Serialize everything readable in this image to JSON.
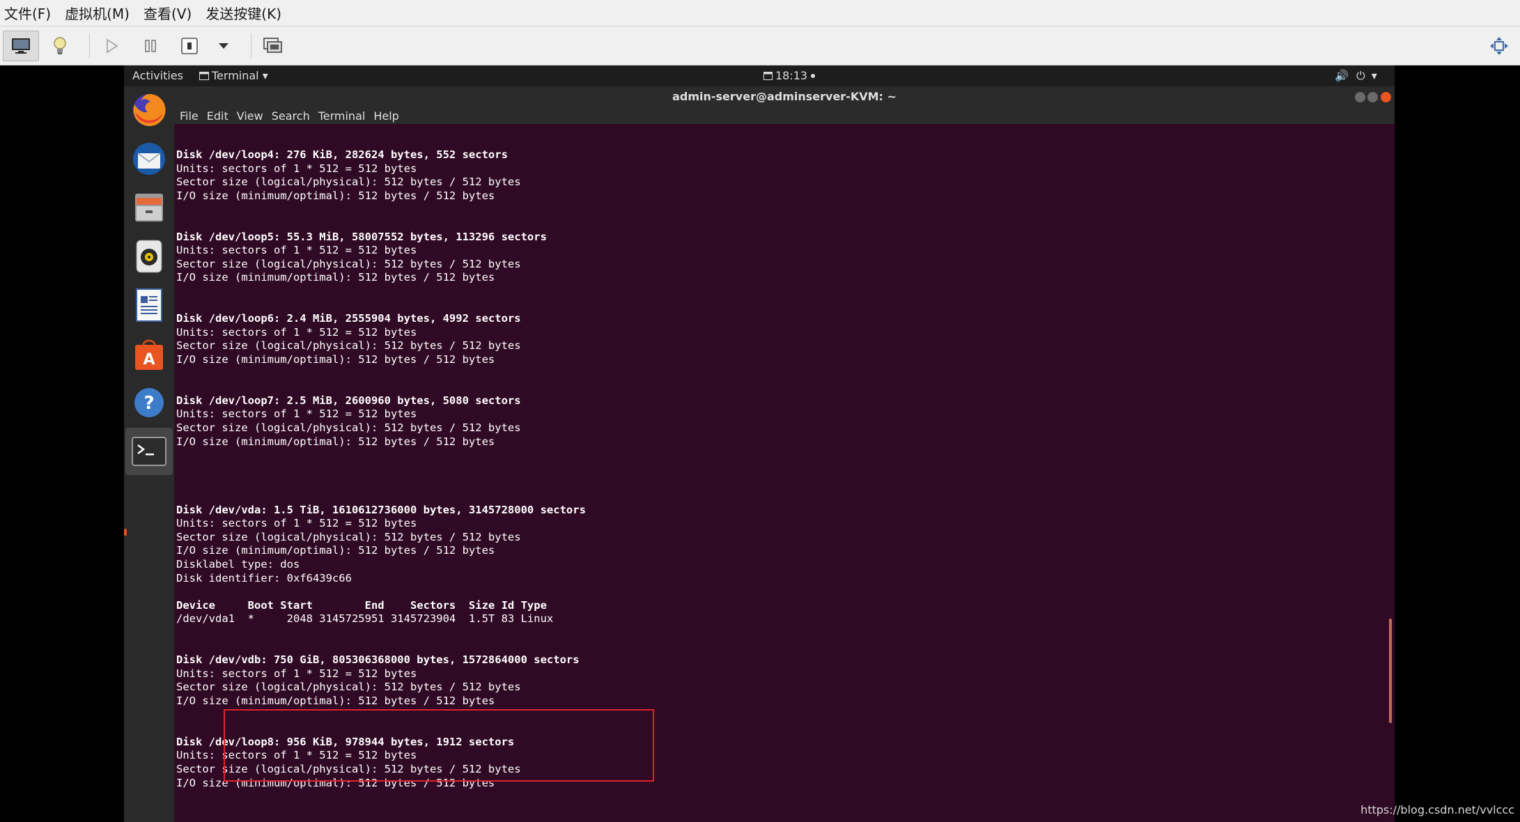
{
  "host": {
    "menu": [
      "文件(F)",
      "虚拟机(M)",
      "查看(V)",
      "发送按键(K)"
    ],
    "toolbar": [
      {
        "name": "display-icon"
      },
      {
        "name": "bulb-icon"
      },
      {
        "name": "play-icon"
      },
      {
        "name": "pause-icon"
      },
      {
        "name": "stop-icon"
      },
      {
        "name": "dropdown-arrow-icon"
      },
      {
        "name": "screens-icon"
      },
      {
        "name": "fullscreen-icon"
      }
    ]
  },
  "gnome": {
    "activities": "Activities",
    "app_menu": "Terminal",
    "clock": "18:13",
    "status_icons": [
      "volume-icon",
      "power-icon",
      "chevron-down-icon"
    ]
  },
  "dock": [
    {
      "name": "firefox-icon"
    },
    {
      "name": "thunderbird-icon"
    },
    {
      "name": "files-icon"
    },
    {
      "name": "rhythmbox-icon"
    },
    {
      "name": "libreoffice-writer-icon"
    },
    {
      "name": "software-center-icon"
    },
    {
      "name": "help-icon"
    },
    {
      "name": "terminal-icon"
    }
  ],
  "terminal": {
    "title": "admin-server@adminserver-KVM: ~",
    "menu": [
      "File",
      "Edit",
      "View",
      "Search",
      "Terminal",
      "Help"
    ],
    "lines": [
      {
        "text": "Disk /dev/loop4: 276 KiB, 282624 bytes, 552 sectors",
        "bold": true
      },
      {
        "text": "Units: sectors of 1 * 512 = 512 bytes"
      },
      {
        "text": "Sector size (logical/physical): 512 bytes / 512 bytes"
      },
      {
        "text": "I/O size (minimum/optimal): 512 bytes / 512 bytes"
      },
      {
        "text": ""
      },
      {
        "text": ""
      },
      {
        "text": "Disk /dev/loop5: 55.3 MiB, 58007552 bytes, 113296 sectors",
        "bold": true
      },
      {
        "text": "Units: sectors of 1 * 512 = 512 bytes"
      },
      {
        "text": "Sector size (logical/physical): 512 bytes / 512 bytes"
      },
      {
        "text": "I/O size (minimum/optimal): 512 bytes / 512 bytes"
      },
      {
        "text": ""
      },
      {
        "text": ""
      },
      {
        "text": "Disk /dev/loop6: 2.4 MiB, 2555904 bytes, 4992 sectors",
        "bold": true
      },
      {
        "text": "Units: sectors of 1 * 512 = 512 bytes"
      },
      {
        "text": "Sector size (logical/physical): 512 bytes / 512 bytes"
      },
      {
        "text": "I/O size (minimum/optimal): 512 bytes / 512 bytes"
      },
      {
        "text": ""
      },
      {
        "text": ""
      },
      {
        "text": "Disk /dev/loop7: 2.5 MiB, 2600960 bytes, 5080 sectors",
        "bold": true
      },
      {
        "text": "Units: sectors of 1 * 512 = 512 bytes"
      },
      {
        "text": "Sector size (logical/physical): 512 bytes / 512 bytes"
      },
      {
        "text": "I/O size (minimum/optimal): 512 bytes / 512 bytes"
      },
      {
        "text": ""
      },
      {
        "text": ""
      },
      {
        "text": ""
      },
      {
        "text": ""
      },
      {
        "text": "Disk /dev/vda: 1.5 TiB, 1610612736000 bytes, 3145728000 sectors",
        "bold": true
      },
      {
        "text": "Units: sectors of 1 * 512 = 512 bytes"
      },
      {
        "text": "Sector size (logical/physical): 512 bytes / 512 bytes"
      },
      {
        "text": "I/O size (minimum/optimal): 512 bytes / 512 bytes"
      },
      {
        "text": "Disklabel type: dos"
      },
      {
        "text": "Disk identifier: 0xf6439c66"
      },
      {
        "text": ""
      },
      {
        "text": "Device     Boot Start        End    Sectors  Size Id Type",
        "bold": true
      },
      {
        "text": "/dev/vda1  *     2048 3145725951 3145723904  1.5T 83 Linux"
      },
      {
        "text": ""
      },
      {
        "text": ""
      },
      {
        "text": "Disk /dev/vdb: 750 GiB, 805306368000 bytes, 1572864000 sectors",
        "bold": true
      },
      {
        "text": "Units: sectors of 1 * 512 = 512 bytes"
      },
      {
        "text": "Sector size (logical/physical): 512 bytes / 512 bytes"
      },
      {
        "text": "I/O size (minimum/optimal): 512 bytes / 512 bytes"
      },
      {
        "text": ""
      },
      {
        "text": ""
      },
      {
        "text": "Disk /dev/loop8: 956 KiB, 978944 bytes, 1912 sectors",
        "bold": true
      },
      {
        "text": "Units: sectors of 1 * 512 = 512 bytes"
      },
      {
        "text": "Sector size (logical/physical): 512 bytes / 512 bytes"
      },
      {
        "text": "I/O size (minimum/optimal): 512 bytes / 512 bytes"
      }
    ]
  },
  "watermark": "https://blog.csdn.net/vvlccc",
  "colors": {
    "terminal_bg": "#300a24",
    "highlight": "#e0242a",
    "ubuntu_orange": "#e95420"
  }
}
